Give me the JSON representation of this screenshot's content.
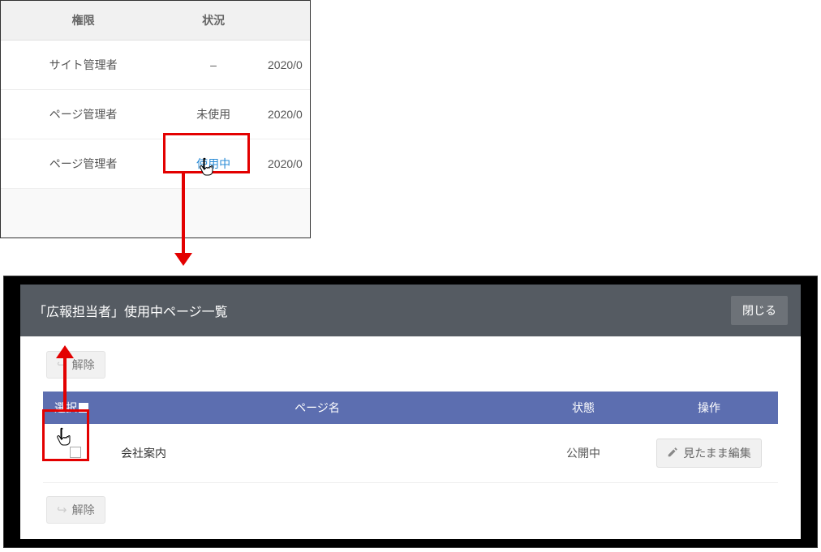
{
  "top_table": {
    "headers": {
      "role": "権限",
      "status": "状況"
    },
    "date_partial": "2020/0",
    "rows": [
      {
        "role": "サイト管理者",
        "status": "–"
      },
      {
        "role": "ページ管理者",
        "status": "未使用"
      },
      {
        "role": "ページ管理者",
        "status": "使用中"
      }
    ]
  },
  "modal": {
    "title": "「広報担当者」使用中ページ一覧",
    "close_label": "閉じる",
    "remove_label": "解除",
    "headers": {
      "select": "選択",
      "page_name": "ページ名",
      "state": "状態",
      "op": "操作"
    },
    "rows": [
      {
        "page_name": "会社案内",
        "state": "公開中",
        "op_label": "見たまま編集"
      }
    ]
  }
}
